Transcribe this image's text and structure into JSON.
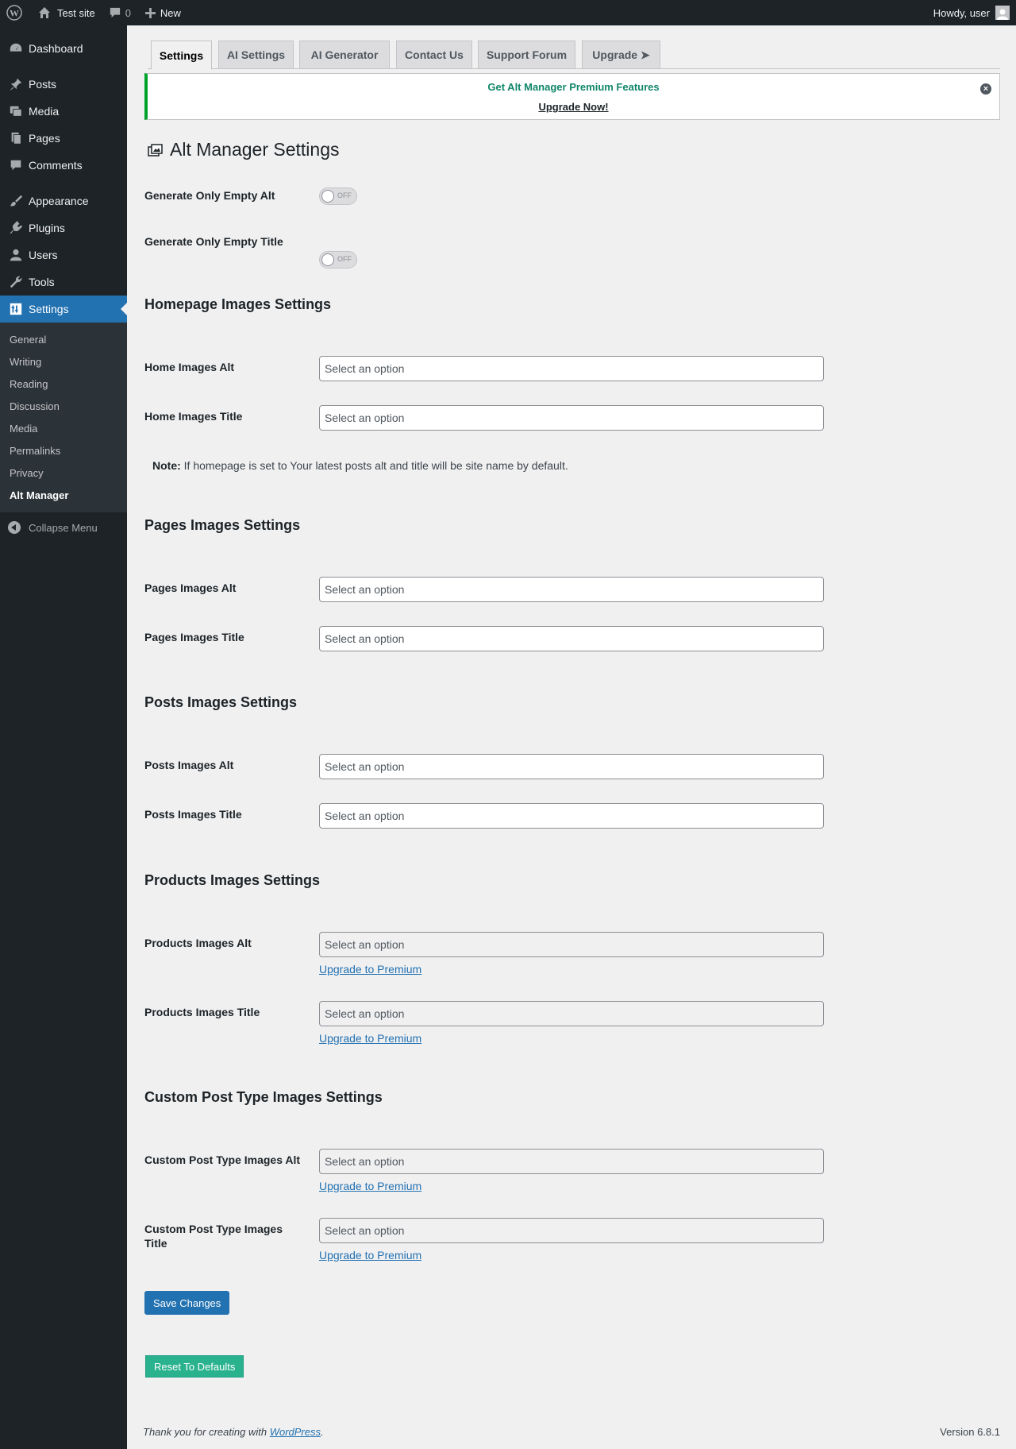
{
  "adminbar": {
    "site_name": "Test site",
    "comments_count": "0",
    "new_label": "New",
    "howdy": "Howdy, user"
  },
  "sidebar": {
    "items": [
      {
        "label": "Dashboard",
        "icon": "dashboard-icon"
      },
      {
        "label": "Posts",
        "icon": "pin-icon"
      },
      {
        "label": "Media",
        "icon": "media-icon"
      },
      {
        "label": "Pages",
        "icon": "pages-icon"
      },
      {
        "label": "Comments",
        "icon": "comment-icon"
      },
      {
        "label": "Appearance",
        "icon": "brush-icon"
      },
      {
        "label": "Plugins",
        "icon": "plug-icon"
      },
      {
        "label": "Users",
        "icon": "user-icon"
      },
      {
        "label": "Tools",
        "icon": "wrench-icon"
      },
      {
        "label": "Settings",
        "icon": "settings-icon"
      }
    ],
    "submenu": [
      "General",
      "Writing",
      "Reading",
      "Discussion",
      "Media",
      "Permalinks",
      "Privacy",
      "Alt Manager"
    ],
    "collapse": "Collapse Menu"
  },
  "tabs": [
    "Settings",
    "AI Settings",
    "AI Generator",
    "Contact Us",
    "Support Forum",
    "Upgrade ➤"
  ],
  "notice": {
    "headline": "Get Alt Manager Premium Features",
    "link": "Upgrade Now!"
  },
  "page_title": "Alt Manager Settings",
  "toggles": [
    {
      "label": "Generate Only Empty Alt",
      "state": "OFF"
    },
    {
      "label": "Generate Only Empty Title",
      "state": "OFF"
    }
  ],
  "sections": {
    "homepage": {
      "heading": "Homepage Images Settings",
      "alt_label": "Home Images Alt",
      "title_label": "Home Images Title",
      "note_bold": "Note:",
      "note_text": " If homepage is set to Your latest posts alt and title will be site name by default."
    },
    "pages": {
      "heading": "Pages Images Settings",
      "alt_label": "Pages Images Alt",
      "title_label": "Pages Images Title"
    },
    "posts": {
      "heading": "Posts Images Settings",
      "alt_label": "Posts Images Alt",
      "title_label": "Posts Images Title"
    },
    "products": {
      "heading": "Products Images Settings",
      "alt_label": "Products Images Alt",
      "title_label": "Products Images Title"
    },
    "cpt": {
      "heading": "Custom Post Type Images Settings",
      "alt_label": "Custom Post Type Images Alt",
      "title_label": "Custom Post Type Images Title"
    }
  },
  "select_placeholder": "Select an option",
  "upgrade_link": "Upgrade to Premium",
  "buttons": {
    "save": "Save Changes",
    "reset": "Reset To Defaults"
  },
  "footer": {
    "thanks_prefix": "Thank you for creating with ",
    "wp_link": "WordPress",
    "thanks_suffix": ".",
    "version": "Version 6.8.1"
  }
}
